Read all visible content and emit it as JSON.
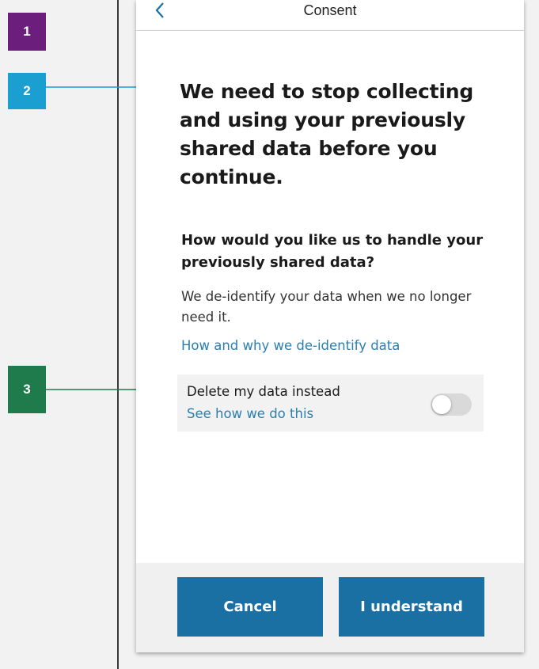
{
  "annotations": [
    {
      "label": "1",
      "color": "#6b1e7b"
    },
    {
      "label": "2",
      "color": "#1a9fd0"
    },
    {
      "label": "3",
      "color": "#1f7a4c"
    }
  ],
  "header": {
    "title": "Consent",
    "back_icon": "chevron-left-icon"
  },
  "main": {
    "headline": "We need to stop collecting and using your previously shared data before you continue.",
    "subheading": "How would you like us to handle your previously shared data?",
    "body": "We de-identify your data when we no longer need it.",
    "link": "How and why we de-identify data"
  },
  "option": {
    "title": "Delete my data instead",
    "link": "See how we do this",
    "toggle_on": false
  },
  "footer": {
    "cancel_label": "Cancel",
    "confirm_label": "I understand"
  },
  "colors": {
    "primary": "#1a6fa3",
    "link": "#2a7fb0"
  }
}
